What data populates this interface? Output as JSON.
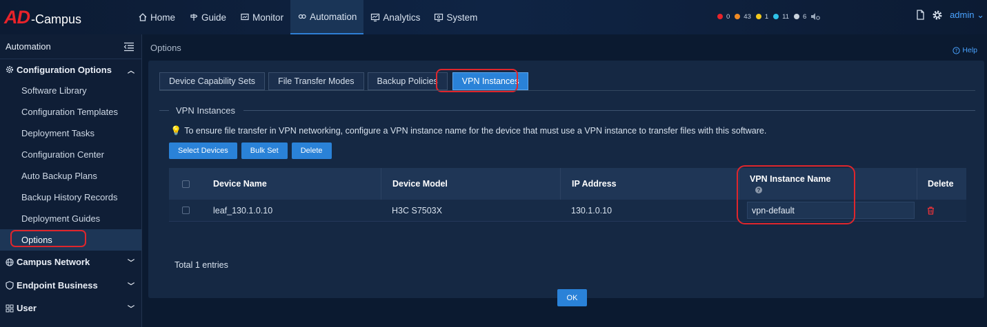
{
  "brand": {
    "logo_mark": "AD",
    "logo_text": "-Campus"
  },
  "nav": [
    {
      "label": "Home",
      "icon": "home-icon"
    },
    {
      "label": "Guide",
      "icon": "signpost-icon"
    },
    {
      "label": "Monitor",
      "icon": "monitor-icon"
    },
    {
      "label": "Automation",
      "icon": "automation-icon",
      "active": true
    },
    {
      "label": "Analytics",
      "icon": "analytics-icon"
    },
    {
      "label": "System",
      "icon": "system-icon"
    }
  ],
  "alarms": [
    {
      "count": "0",
      "color": "#e8232a"
    },
    {
      "count": "43",
      "color": "#f08a24"
    },
    {
      "count": "1",
      "color": "#f2c81e"
    },
    {
      "count": "11",
      "color": "#2fc2e8"
    },
    {
      "count": "6",
      "color": "#c9d2dd"
    }
  ],
  "user": {
    "name": "admin"
  },
  "sidebar": {
    "title": "Automation",
    "groups": [
      {
        "label": "Configuration Options",
        "expanded": true,
        "items": [
          {
            "label": "Software Library"
          },
          {
            "label": "Configuration Templates"
          },
          {
            "label": "Deployment Tasks"
          },
          {
            "label": "Configuration Center"
          },
          {
            "label": "Auto Backup Plans"
          },
          {
            "label": "Backup History Records"
          },
          {
            "label": "Deployment Guides"
          },
          {
            "label": "Options",
            "active": true
          }
        ]
      },
      {
        "label": "Campus Network"
      },
      {
        "label": "Endpoint Business"
      },
      {
        "label": "User"
      }
    ]
  },
  "main": {
    "breadcrumb": "Options",
    "help_label": "Help",
    "tabs": [
      {
        "label": "Device Capability Sets"
      },
      {
        "label": "File Transfer Modes"
      },
      {
        "label": "Backup Policies"
      },
      {
        "label": "VPN Instances",
        "active": true
      }
    ],
    "section_title": "VPN Instances",
    "tip": "To ensure file transfer in VPN networking, configure a VPN instance name for the device that must use a VPN instance to transfer files with this software.",
    "buttons": {
      "select_devices": "Select Devices",
      "bulk_set": "Bulk Set",
      "delete": "Delete"
    },
    "table": {
      "headers": [
        "Device Name",
        "Device Model",
        "IP Address",
        "VPN Instance Name",
        "Delete"
      ],
      "rows": [
        {
          "device_name": "leaf_130.1.0.10",
          "device_model": "H3C S7503X",
          "ip_address": "130.1.0.10",
          "vpn_instance_name": "vpn-default"
        }
      ]
    },
    "total": "Total 1 entries",
    "ok_label": "OK"
  },
  "colors": {
    "accent": "#2a82d8",
    "highlight": "#e0262c",
    "brand_red": "#e8232a"
  }
}
